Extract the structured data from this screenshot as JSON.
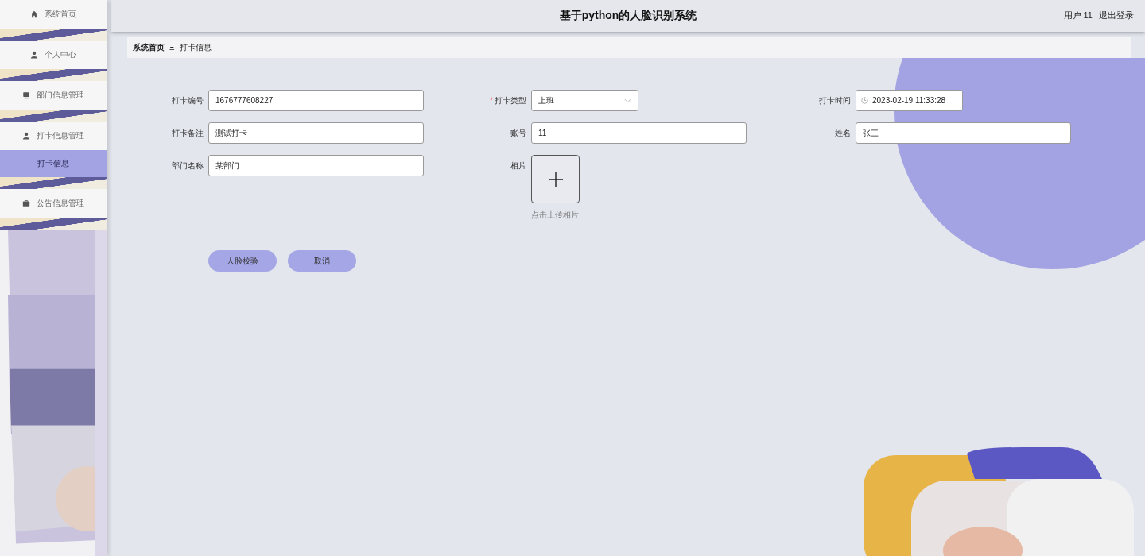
{
  "header": {
    "title": "基于python的人脸识别系统",
    "user": "用户 11",
    "logout": "退出登录"
  },
  "sidebar": {
    "items": [
      {
        "label": "系统首页",
        "selected": false
      },
      {
        "label": "个人中心",
        "selected": false
      },
      {
        "label": "部门信息管理",
        "selected": false
      },
      {
        "label": "打卡信息管理",
        "selected": false,
        "children": [
          {
            "label": "打卡信息",
            "selected": true
          }
        ]
      },
      {
        "label": "公告信息管理",
        "selected": false
      }
    ]
  },
  "breadcrumb": {
    "items": [
      "系统首页",
      "打卡信息"
    ],
    "separator": "Ξ"
  },
  "form": {
    "fields": [
      {
        "label": "打卡编号",
        "kind": "text",
        "value": "1676777608227"
      },
      {
        "label": "打卡类型",
        "kind": "select",
        "value": "上班",
        "required_mark": "*"
      },
      {
        "label": "打卡时间",
        "kind": "datetime",
        "value": "2023-02-19 11:33:28"
      },
      {
        "label": "打卡备注",
        "kind": "text",
        "value": "测试打卡"
      },
      {
        "label": "账号",
        "kind": "text",
        "value": "11"
      },
      {
        "label": "姓名",
        "kind": "text",
        "value": "张三"
      },
      {
        "label": "部门名称",
        "kind": "text",
        "value": "某部门"
      },
      {
        "label": "相片",
        "kind": "upload",
        "hint": "点击上传相片"
      }
    ],
    "buttons": [
      "人脸校验",
      "取消"
    ]
  }
}
